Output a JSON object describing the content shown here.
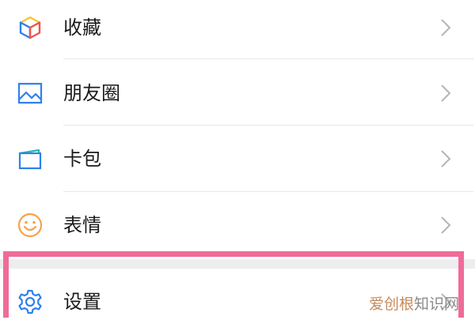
{
  "menu": {
    "items": [
      {
        "label": "收藏",
        "icon": "favorites-cube-icon"
      },
      {
        "label": "朋友圈",
        "icon": "moments-image-icon"
      },
      {
        "label": "卡包",
        "icon": "card-wallet-icon"
      },
      {
        "label": "表情",
        "icon": "smiley-face-icon"
      },
      {
        "label": "设置",
        "icon": "settings-gear-icon"
      }
    ],
    "chevron": "chevron-right-icon"
  },
  "watermark": {
    "part1": "爱创根",
    "part2": "知识网"
  },
  "colors": {
    "highlight": "#ef6b9a",
    "divider": "#e7e7e7",
    "group_gap": "#ededed",
    "icon_blue": "#2f80ed",
    "icon_teal": "#27b8a8",
    "icon_orange": "#f5a24b",
    "icon_yellow": "#f7c52e",
    "icon_red": "#ef5350"
  }
}
